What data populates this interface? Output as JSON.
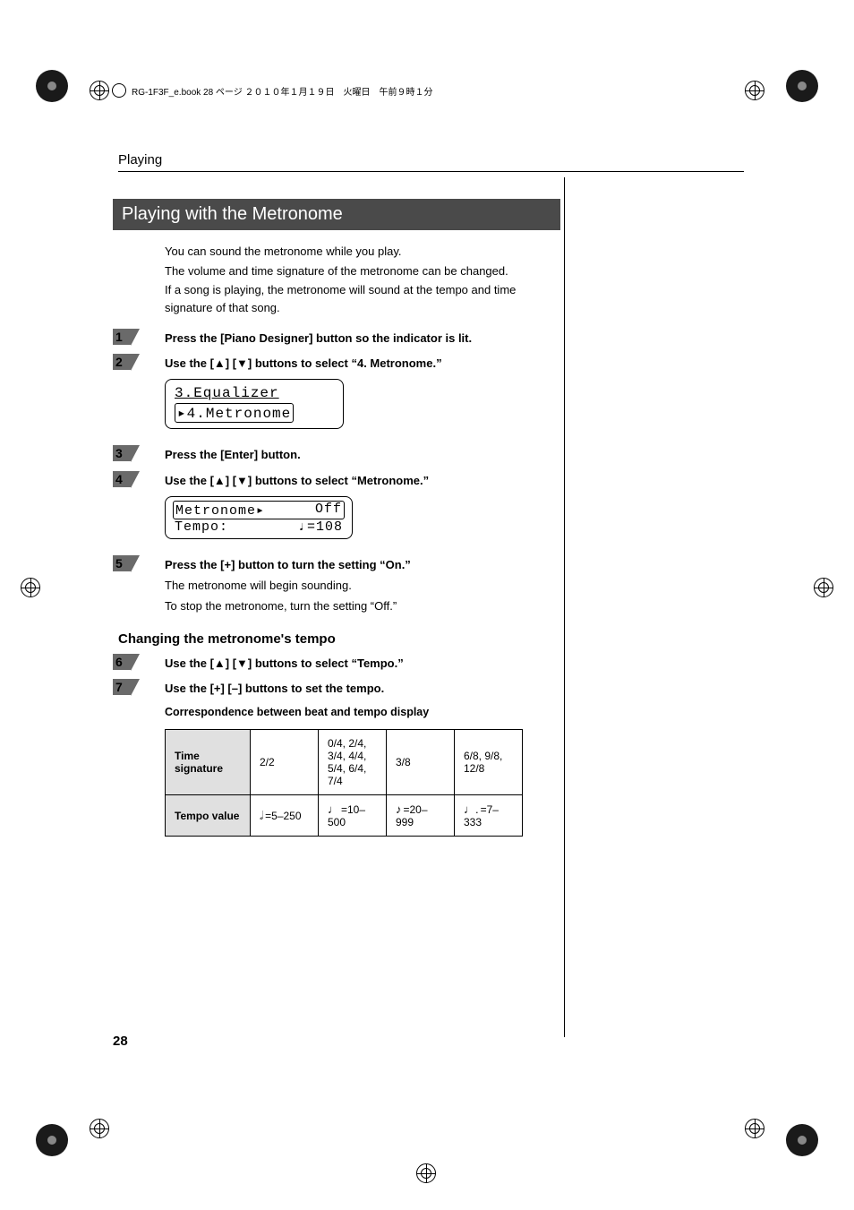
{
  "runhead": "RG-1F3F_e.book 28 ページ ２０１０年１月１９日　火曜日　午前９時１分",
  "section_title": "Playing",
  "heading": "Playing with the Metronome",
  "intro": {
    "p1": "You can sound the metronome while you play.",
    "p2": "The volume and time signature of the metronome can be changed.",
    "p3": "If a song is playing, the metronome will sound at the tempo and time signature of that song."
  },
  "steps": {
    "s1": {
      "num": "1",
      "text": "Press the [Piano Designer] button so the indicator is lit."
    },
    "s2": {
      "num": "2",
      "text": "Use the [▲] [▼] buttons to select “4. Metronome.”"
    },
    "lcd1": {
      "row1": "3.Equalizer",
      "row2": "▸4.Metronome"
    },
    "s3": {
      "num": "3",
      "text": "Press the [Enter] button."
    },
    "s4": {
      "num": "4",
      "text": "Use the [▲] [▼] buttons to select “Metronome.”"
    },
    "lcd2": {
      "row1_left": "Metronome▸",
      "row1_right": "Off",
      "row2_left": "Tempo:",
      "row2_right": "♩=108"
    },
    "s5": {
      "num": "5",
      "text": "Press the [+] button to turn the setting “On.”",
      "sub1": "The metronome will begin sounding.",
      "sub2": "To stop the metronome, turn the setting “Off.”"
    }
  },
  "subhead_tempo": "Changing the metronome's tempo",
  "steps2": {
    "s6": {
      "num": "6",
      "text": "Use the [▲] [▼] buttons to select “Tempo.”"
    },
    "s7": {
      "num": "7",
      "text": "Use the [+] [–] buttons to set the tempo."
    }
  },
  "corr_title": "Correspondence between beat and tempo display",
  "table": {
    "rows": {
      "r1": {
        "header": "Time signature",
        "c1": "2/2",
        "c2": "0/4, 2/4, 3/4, 4/4, 5/4, 6/4, 7/4",
        "c3": "3/8",
        "c4": "6/8, 9/8, 12/8"
      },
      "r2": {
        "header": "Tempo value",
        "n1": "𝅗𝅥",
        "c1": "=5–250",
        "n2": "♩",
        "c2": "=10–500",
        "n3": "♪",
        "c3": "=20–999",
        "n4": "♩.",
        "c4": "=7–333"
      }
    }
  },
  "page_number": "28"
}
